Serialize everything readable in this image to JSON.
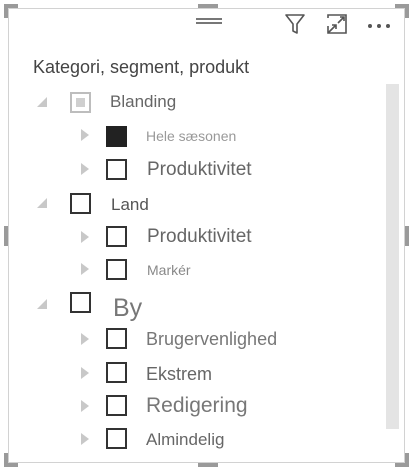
{
  "visual": {
    "title": "Kategori, segment, produkt"
  },
  "toolbar": {
    "icons": [
      "filter-icon",
      "focus-mode-icon",
      "more-options-icon"
    ]
  },
  "colors": {
    "border": "#d2d2d2",
    "text": "#444444",
    "muted": "#9a9a9a",
    "checked": "#222222"
  },
  "tree": {
    "blanding": {
      "label": "Blanding",
      "state": "partial",
      "children": {
        "hele_saesonen": {
          "label": "Hele sæsonen",
          "state": "checked"
        },
        "produktivitet": {
          "label": "Produktivitet",
          "state": "unchecked"
        }
      }
    },
    "land": {
      "label": "Land",
      "state": "unchecked",
      "children": {
        "produktivitet": {
          "label": "Produktivitet",
          "state": "unchecked"
        },
        "marker": {
          "label": "Markér",
          "state": "unchecked"
        }
      }
    },
    "by": {
      "label": "By",
      "state": "unchecked",
      "children": {
        "brugervenlighed": {
          "label": "Brugervenlighed",
          "state": "unchecked"
        },
        "ekstrem": {
          "label": "Ekstrem",
          "state": "unchecked"
        },
        "redigering": {
          "label": "Redigering",
          "state": "unchecked"
        },
        "almindelig": {
          "label": "Almindelig",
          "state": "unchecked"
        }
      }
    }
  }
}
